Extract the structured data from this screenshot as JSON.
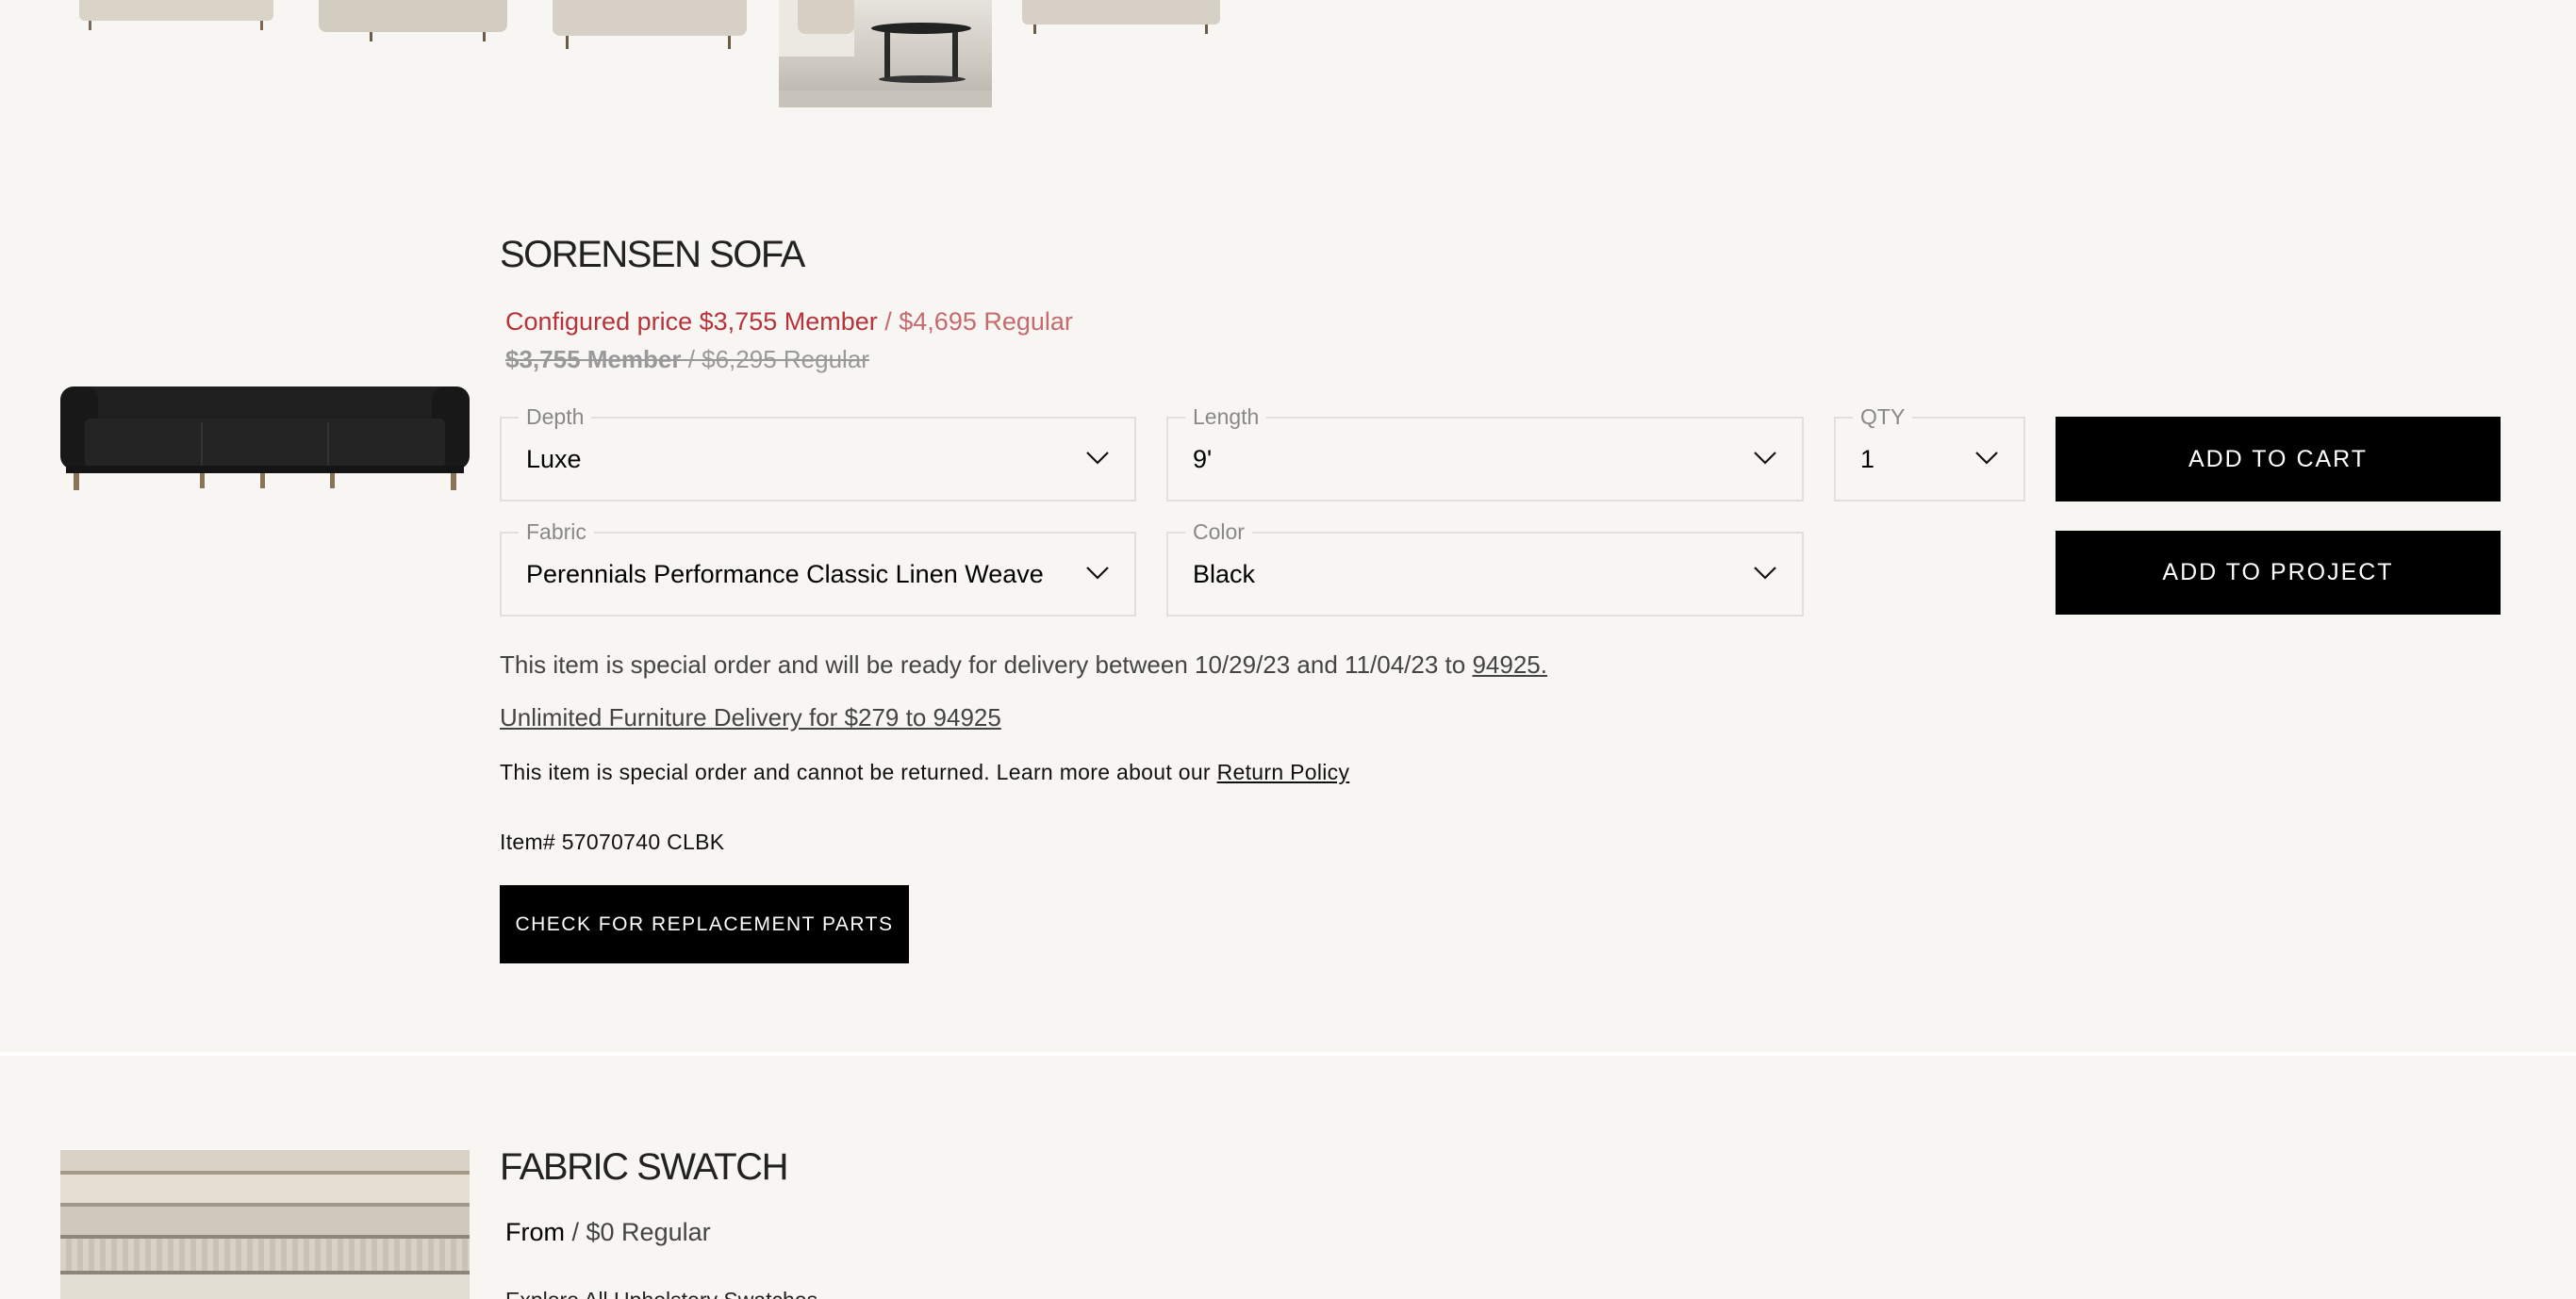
{
  "product": {
    "title": "SORENSEN SOFA",
    "configured_label": "Configured price",
    "member_price": "$3,755 Member",
    "regular_price": "/ $4,695 Regular",
    "orig_member_price": "$3,755 Member",
    "orig_regular_price": "/ $6,295 Regular",
    "options": {
      "depth": {
        "label": "Depth",
        "value": "Luxe"
      },
      "length": {
        "label": "Length",
        "value": "9'"
      },
      "qty": {
        "label": "QTY",
        "value": "1"
      },
      "fabric": {
        "label": "Fabric",
        "value": "Perennials Performance Classic Linen Weave"
      },
      "color": {
        "label": "Color",
        "value": "Black"
      }
    },
    "add_to_cart": "ADD TO CART",
    "add_to_project": "ADD TO PROJECT",
    "delivery_text": "This item is special order and will be ready for delivery between 10/29/23 and 11/04/23 to",
    "delivery_zip": "94925.",
    "unlimited_delivery": "Unlimited Furniture Delivery for $279 to 94925",
    "return_text": "This item is special order and cannot be returned. Learn more about our",
    "return_policy": "Return Policy",
    "item_number": "Item# 57070740 CLBK",
    "replacement_parts": "CHECK FOR REPLACEMENT PARTS",
    "image_icon": "black-sofa-image"
  },
  "swatch": {
    "title": "FABRIC SWATCH",
    "from_label": "From",
    "price": "/ $0 Regular",
    "explore": "Explore All Upholstery Swatches"
  },
  "colors": {
    "background": "#f8f6f3",
    "member_red": "#b8323a",
    "regular_red": "#c66a6e",
    "button_black": "#000000"
  }
}
